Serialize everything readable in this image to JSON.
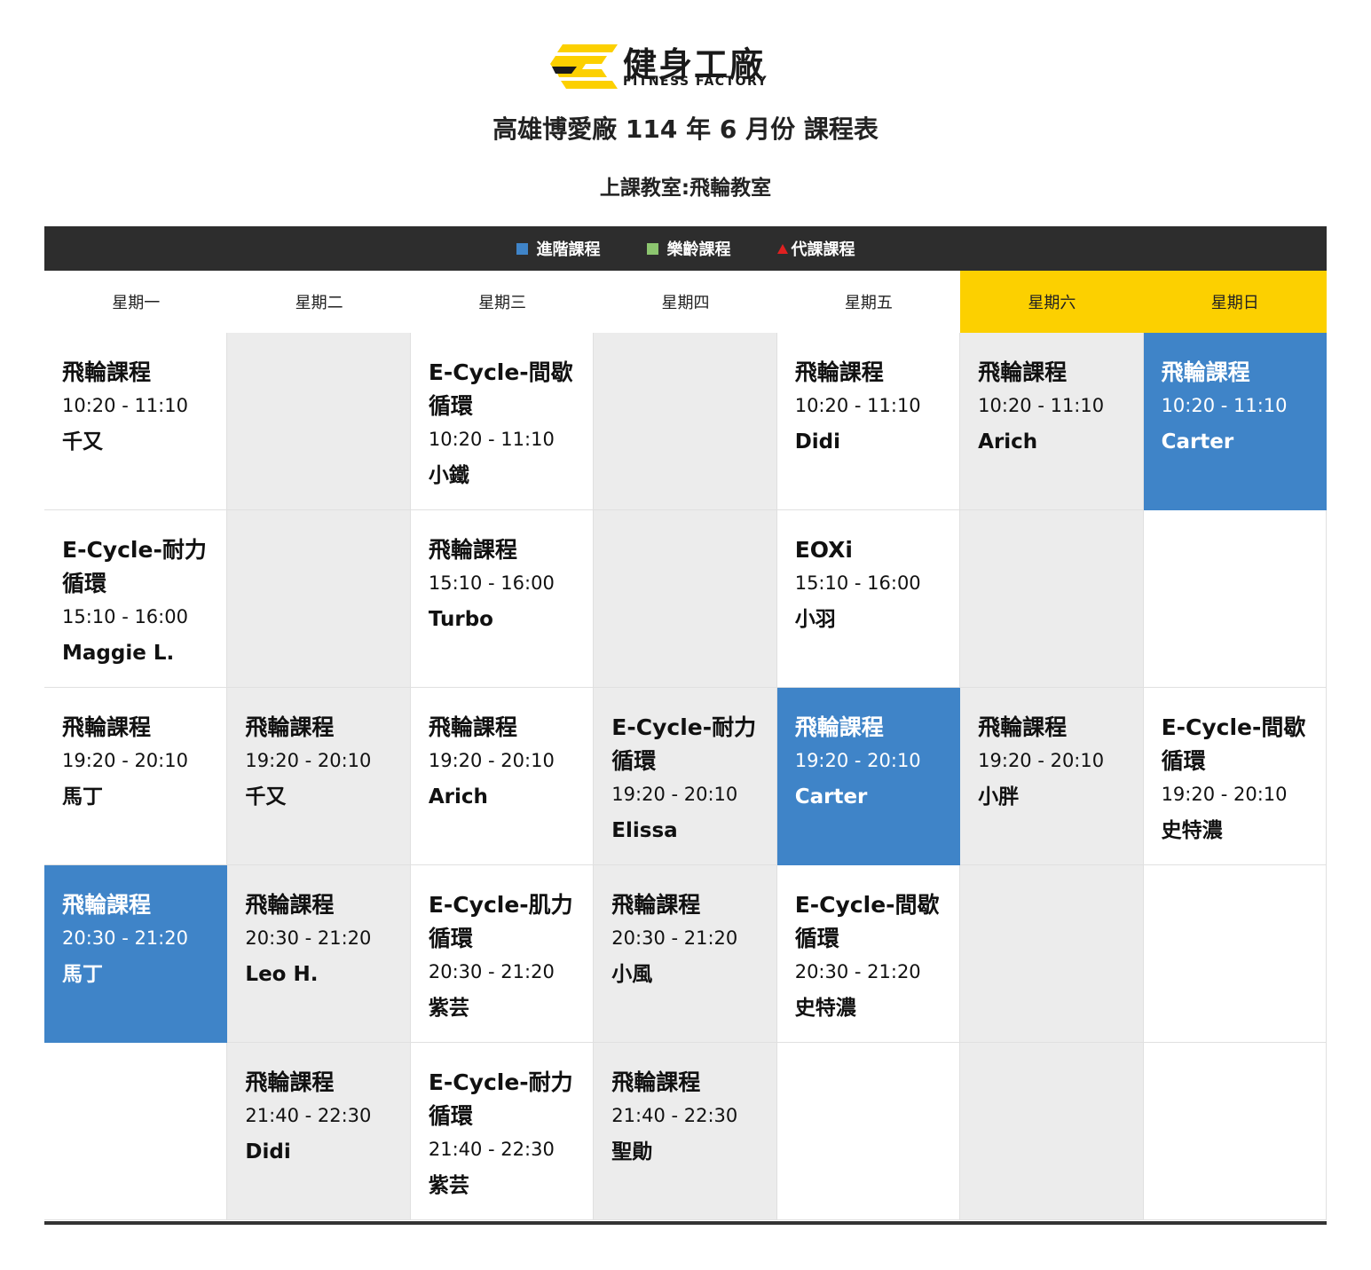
{
  "brand": {
    "name_cn": "健身工廠",
    "name_en": "FITNESS FACTORY",
    "logo_icon": "fitness-factory-logo-icon",
    "logo_color": "#fcd000"
  },
  "title": "高雄博愛廠 114 年 6 月份 課程表",
  "subtitle": "上課教室:飛輪教室",
  "legend": [
    {
      "label": "進階課程",
      "color": "#3f84c8",
      "shape": "square"
    },
    {
      "label": "樂齡課程",
      "color": "#8cc56f",
      "shape": "square"
    },
    {
      "label": "代課課程",
      "color": "#e02020",
      "shape": "triangle"
    }
  ],
  "days": [
    "星期一",
    "星期二",
    "星期三",
    "星期四",
    "星期五",
    "星期六",
    "星期日"
  ],
  "weekend_color": "#fcd000",
  "advanced_color": "#3f84c8",
  "rows": [
    [
      {
        "name": "飛輪課程",
        "time": "10:20 - 11:10",
        "coach": "千又",
        "style": "white"
      },
      {
        "style": "gray"
      },
      {
        "name": "E-Cycle-間歇循環",
        "time": "10:20 - 11:10",
        "coach": "小鐵",
        "style": "white"
      },
      {
        "style": "gray"
      },
      {
        "name": "飛輪課程",
        "time": "10:20 - 11:10",
        "coach": "Didi",
        "style": "white"
      },
      {
        "name": "飛輪課程",
        "time": "10:20 - 11:10",
        "coach": "Arich",
        "style": "gray"
      },
      {
        "name": "飛輪課程",
        "time": "10:20 - 11:10",
        "coach": "Carter",
        "style": "blue"
      }
    ],
    [
      {
        "name": "E-Cycle-耐力循環",
        "time": "15:10 - 16:00",
        "coach": "Maggie L.",
        "style": "white"
      },
      {
        "style": "gray"
      },
      {
        "name": "飛輪課程",
        "time": "15:10 - 16:00",
        "coach": "Turbo",
        "style": "white"
      },
      {
        "style": "gray"
      },
      {
        "name": "EOXi",
        "time": "15:10 - 16:00",
        "coach": "小羽",
        "style": "white"
      },
      {
        "style": "gray"
      },
      {
        "style": "white"
      }
    ],
    [
      {
        "name": "飛輪課程",
        "time": "19:20 - 20:10",
        "coach": "馬丁",
        "style": "white"
      },
      {
        "name": "飛輪課程",
        "time": "19:20 - 20:10",
        "coach": "千又",
        "style": "gray"
      },
      {
        "name": "飛輪課程",
        "time": "19:20 - 20:10",
        "coach": "Arich",
        "style": "white"
      },
      {
        "name": "E-Cycle-耐力循環",
        "time": "19:20 - 20:10",
        "coach": "Elissa",
        "style": "gray"
      },
      {
        "name": "飛輪課程",
        "time": "19:20 - 20:10",
        "coach": "Carter",
        "style": "blue"
      },
      {
        "name": "飛輪課程",
        "time": "19:20 - 20:10",
        "coach": "小胖",
        "style": "gray"
      },
      {
        "name": "E-Cycle-間歇循環",
        "time": "19:20 - 20:10",
        "coach": "史特濃",
        "style": "white"
      }
    ],
    [
      {
        "name": "飛輪課程",
        "time": "20:30 - 21:20",
        "coach": "馬丁",
        "style": "blue"
      },
      {
        "name": "飛輪課程",
        "time": "20:30 - 21:20",
        "coach": "Leo H.",
        "style": "gray"
      },
      {
        "name": "E-Cycle-肌力循環",
        "time": "20:30 - 21:20",
        "coach": "紫芸",
        "style": "white"
      },
      {
        "name": "飛輪課程",
        "time": "20:30 - 21:20",
        "coach": "小風",
        "style": "gray"
      },
      {
        "name": "E-Cycle-間歇循環",
        "time": "20:30 - 21:20",
        "coach": "史特濃",
        "style": "white"
      },
      {
        "style": "gray"
      },
      {
        "style": "white"
      }
    ],
    [
      {
        "style": "white"
      },
      {
        "name": "飛輪課程",
        "time": "21:40 - 22:30",
        "coach": "Didi",
        "style": "gray"
      },
      {
        "name": "E-Cycle-耐力循環",
        "time": "21:40 - 22:30",
        "coach": "紫芸",
        "style": "white"
      },
      {
        "name": "飛輪課程",
        "time": "21:40 - 22:30",
        "coach": "聖勛",
        "style": "gray"
      },
      {
        "style": "white"
      },
      {
        "style": "gray"
      },
      {
        "style": "white"
      }
    ]
  ]
}
